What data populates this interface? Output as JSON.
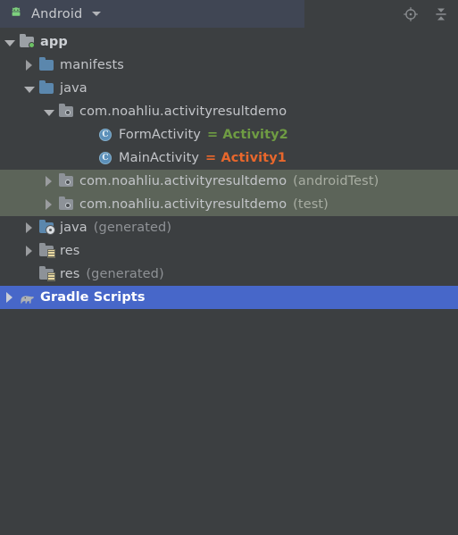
{
  "header": {
    "tab_label": "Android",
    "android_icon": "android-robot-icon",
    "caret_icon": "chevron-down-icon",
    "actions": [
      {
        "name": "select-opened-file-icon",
        "title": "Select Opened File"
      },
      {
        "name": "collapse-all-icon",
        "title": "Collapse All"
      }
    ],
    "tab_background": "#404654",
    "background": "#3c3f41"
  },
  "colors": {
    "background": "#3c3f41",
    "selection_blue": "#4767c9",
    "highlight_olive": "#5c6459",
    "text": "#c3c5c9",
    "text_muted": "#8f9296",
    "annotation_green": "#6f9c43",
    "annotation_orange": "#e8672c",
    "folder_blue": "#5b87ad",
    "folder_gray": "#9ba0a5",
    "module_badge_green": "#6cc164"
  },
  "tree": {
    "rows": [
      {
        "name": "tree-item-app",
        "indent": "i0",
        "twisty": "expanded",
        "icon": "module-folder-icon",
        "label": "app",
        "suffix": "",
        "annotation": "",
        "annotation_color": "",
        "state": "normal",
        "bold": true
      },
      {
        "name": "tree-item-manifests",
        "indent": "i1",
        "twisty": "collapsed",
        "icon": "folder-blue-icon",
        "label": "manifests",
        "suffix": "",
        "annotation": "",
        "annotation_color": "",
        "state": "normal",
        "bold": false
      },
      {
        "name": "tree-item-java",
        "indent": "i1",
        "twisty": "expanded",
        "icon": "folder-blue-icon",
        "label": "java",
        "suffix": "",
        "annotation": "",
        "annotation_color": "",
        "state": "normal",
        "bold": false
      },
      {
        "name": "tree-item-package-main",
        "indent": "i2",
        "twisty": "expanded",
        "icon": "package-folder-icon",
        "label": "com.noahliu.activityresultdemo",
        "suffix": "",
        "annotation": "",
        "annotation_color": "",
        "state": "normal",
        "bold": false
      },
      {
        "name": "tree-item-class-formactivity",
        "indent": "i3b",
        "twisty": "none",
        "icon": "java-class-icon",
        "label": "FormActivity",
        "suffix": "",
        "annotation": "= Activity2",
        "annotation_color": "green",
        "state": "normal",
        "bold": false
      },
      {
        "name": "tree-item-class-mainactivity",
        "indent": "i3b",
        "twisty": "none",
        "icon": "java-class-icon",
        "label": "MainActivity",
        "suffix": "",
        "annotation": "= Activity1",
        "annotation_color": "orange",
        "state": "normal",
        "bold": false
      },
      {
        "name": "tree-item-package-androidtest",
        "indent": "i2",
        "twisty": "collapsed",
        "icon": "package-folder-icon",
        "label": "com.noahliu.activityresultdemo",
        "suffix": "(androidTest)",
        "annotation": "",
        "annotation_color": "",
        "state": "highlighted",
        "bold": false
      },
      {
        "name": "tree-item-package-test",
        "indent": "i2",
        "twisty": "collapsed",
        "icon": "package-folder-icon",
        "label": "com.noahliu.activityresultdemo",
        "suffix": "(test)",
        "annotation": "",
        "annotation_color": "",
        "state": "highlighted",
        "bold": false
      },
      {
        "name": "tree-item-java-generated",
        "indent": "i1",
        "twisty": "collapsed",
        "icon": "folder-generated-icon",
        "label": "java",
        "suffix": "(generated)",
        "annotation": "",
        "annotation_color": "",
        "state": "normal",
        "bold": false
      },
      {
        "name": "tree-item-res",
        "indent": "i1",
        "twisty": "collapsed",
        "icon": "folder-res-icon",
        "label": "res",
        "suffix": "",
        "annotation": "",
        "annotation_color": "",
        "state": "normal",
        "bold": false
      },
      {
        "name": "tree-item-res-generated",
        "indent": "i1",
        "twisty": "none",
        "icon": "folder-res-icon",
        "label": "res",
        "suffix": "(generated)",
        "annotation": "",
        "annotation_color": "",
        "state": "normal",
        "bold": false
      },
      {
        "name": "tree-item-gradle-scripts",
        "indent": "i0",
        "twisty": "collapsed",
        "icon": "gradle-elephant-icon",
        "label": "Gradle Scripts",
        "suffix": "",
        "annotation": "",
        "annotation_color": "",
        "state": "selected",
        "bold": true
      }
    ]
  }
}
